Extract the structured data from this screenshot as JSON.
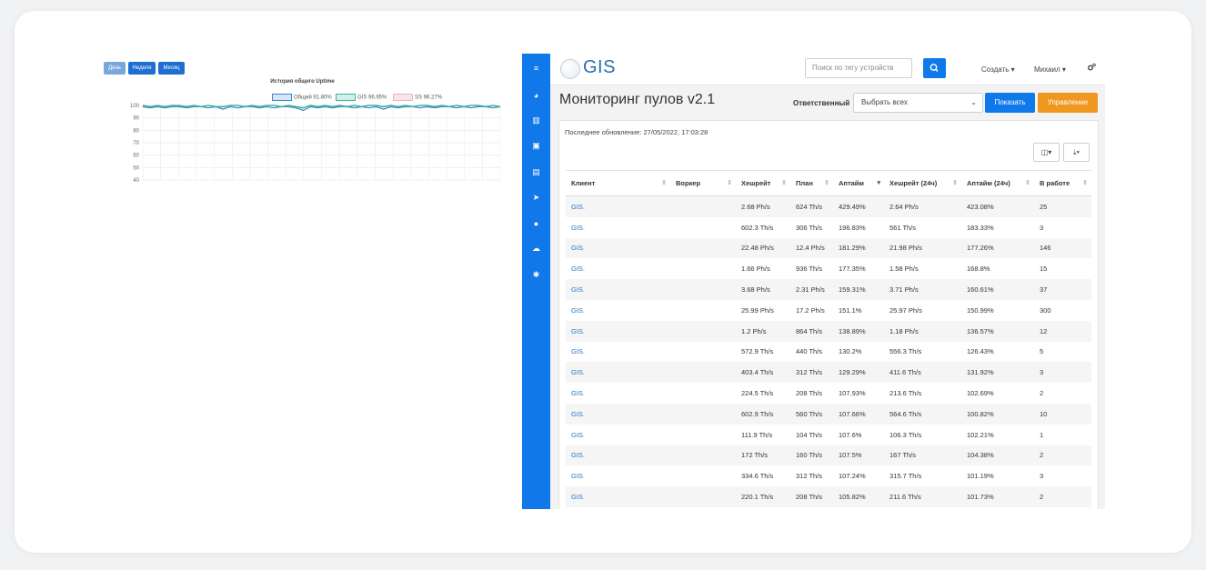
{
  "chart": {
    "buttons": [
      {
        "label": "День",
        "color": "#7aa7d9"
      },
      {
        "label": "Неделя",
        "color": "#1f6fd1"
      },
      {
        "label": "Месяц",
        "color": "#1f6fd1"
      }
    ],
    "title": "История общего Uptime",
    "legend": [
      "Общий 91.80%",
      "GIS 96.95%",
      "SS 96.27%"
    ]
  },
  "chart_data": {
    "type": "line",
    "title": "История общего Uptime",
    "yticks": [
      100,
      90,
      80,
      70,
      60,
      50,
      40
    ],
    "ylim": [
      40,
      100
    ],
    "grid": true,
    "legend_position": "top",
    "series": [
      {
        "name": "Общий 91.80%",
        "color": "#3e86c9",
        "values": [
          99,
          98,
          99,
          98,
          99,
          99,
          98,
          99,
          99,
          98,
          99,
          97,
          99,
          98,
          99,
          99,
          98,
          99,
          98,
          99,
          99,
          98,
          96,
          99,
          98,
          99,
          98,
          99,
          99,
          98,
          99,
          98,
          99,
          97,
          99,
          98,
          99,
          99,
          98,
          99,
          98,
          99,
          99,
          98,
          99,
          98,
          99,
          99,
          98,
          99
        ]
      },
      {
        "name": "GIS 96.95%",
        "color": "#3db39e",
        "values": [
          100,
          99,
          100,
          99,
          100,
          100,
          99,
          100,
          99,
          100,
          99,
          99,
          100,
          100,
          99,
          100,
          99,
          100,
          100,
          99,
          100,
          99,
          98,
          100,
          99,
          100,
          99,
          100,
          99,
          100,
          99,
          100,
          100,
          99,
          100,
          99,
          100,
          99,
          100,
          100,
          99,
          100,
          99,
          100,
          99,
          100,
          100,
          99,
          100,
          99
        ]
      },
      {
        "name": "SS 96.27%",
        "color": "#e07b86",
        "values": []
      }
    ]
  },
  "app": {
    "sidebar_icons": [
      "menu-icon",
      "dashboard-icon",
      "barcode-icon",
      "book-icon",
      "id-card-icon",
      "location-arrow-icon",
      "users-icon",
      "cloud-upload-icon",
      "gear-icon"
    ],
    "logo": {
      "text": "GIS"
    },
    "search": {
      "placeholder": "Поиск по тегу устройств"
    },
    "create_label": "Создать ▾",
    "user_label": "Михаил ▾",
    "title": "Мониторинг пулов v2.1",
    "responsible_label": "Ответственный",
    "responsible_value": "Выбрать всех",
    "show_label": "Показать",
    "manage_label": "Управление",
    "updated": "Последнее обновление: 27/05/2022, 17:03:28",
    "columns": [
      "Клиент",
      "Воркер",
      "Хешрейт",
      "План",
      "Аптайм",
      "Хешрейт (24ч)",
      "Аптайм (24ч)",
      "В работе"
    ],
    "rows": [
      {
        "client": "GIS.",
        "worker": "",
        "hashrate": "2.68 Ph/s",
        "plan": "624 Th/s",
        "uptime": "429.49%",
        "hashrate24": "2.64 Ph/s",
        "uptime24": "423.08%",
        "working": "25"
      },
      {
        "client": "GIS.",
        "worker": "",
        "hashrate": "602.3 Th/s",
        "plan": "306 Th/s",
        "uptime": "196.83%",
        "hashrate24": "561 Th/s",
        "uptime24": "183.33%",
        "working": "3"
      },
      {
        "client": "GIS.",
        "worker": "",
        "hashrate": "22.48 Ph/s",
        "plan": "12.4 Ph/s",
        "uptime": "181.29%",
        "hashrate24": "21.98 Ph/s",
        "uptime24": "177.26%",
        "working": "146"
      },
      {
        "client": "GIS.",
        "worker": "",
        "hashrate": "1.66 Ph/s",
        "plan": "936 Th/s",
        "uptime": "177.35%",
        "hashrate24": "1.58 Ph/s",
        "uptime24": "168.8%",
        "working": "15"
      },
      {
        "client": "GIS.",
        "worker": "",
        "hashrate": "3.68 Ph/s",
        "plan": "2.31 Ph/s",
        "uptime": "159.31%",
        "hashrate24": "3.71 Ph/s",
        "uptime24": "160.61%",
        "working": "37"
      },
      {
        "client": "GIS.",
        "worker": "",
        "hashrate": "25.99 Ph/s",
        "plan": "17.2 Ph/s",
        "uptime": "151.1%",
        "hashrate24": "25.97 Ph/s",
        "uptime24": "150.99%",
        "working": "300"
      },
      {
        "client": "GIS.",
        "worker": "",
        "hashrate": "1.2 Ph/s",
        "plan": "864 Th/s",
        "uptime": "138.89%",
        "hashrate24": "1.18 Ph/s",
        "uptime24": "136.57%",
        "working": "12"
      },
      {
        "client": "GIS.",
        "worker": "",
        "hashrate": "572.9 Th/s",
        "plan": "440 Th/s",
        "uptime": "130.2%",
        "hashrate24": "556.3 Th/s",
        "uptime24": "126.43%",
        "working": "5"
      },
      {
        "client": "GIS.",
        "worker": "",
        "hashrate": "403.4 Th/s",
        "plan": "312 Th/s",
        "uptime": "129.29%",
        "hashrate24": "411.6 Th/s",
        "uptime24": "131.92%",
        "working": "3"
      },
      {
        "client": "GIS.",
        "worker": "",
        "hashrate": "224.5 Th/s",
        "plan": "208 Th/s",
        "uptime": "107.93%",
        "hashrate24": "213.6 Th/s",
        "uptime24": "102.69%",
        "working": "2"
      },
      {
        "client": "GIS.",
        "worker": "",
        "hashrate": "602.9 Th/s",
        "plan": "560 Th/s",
        "uptime": "107.66%",
        "hashrate24": "564.6 Th/s",
        "uptime24": "100.82%",
        "working": "10"
      },
      {
        "client": "GIS.",
        "worker": "",
        "hashrate": "111.9 Th/s",
        "plan": "104 Th/s",
        "uptime": "107.6%",
        "hashrate24": "106.3 Th/s",
        "uptime24": "102.21%",
        "working": "1"
      },
      {
        "client": "GIS.",
        "worker": "",
        "hashrate": "172 Th/s",
        "plan": "160 Th/s",
        "uptime": "107.5%",
        "hashrate24": "167 Th/s",
        "uptime24": "104.38%",
        "working": "2"
      },
      {
        "client": "GIS.",
        "worker": "",
        "hashrate": "334.6 Th/s",
        "plan": "312 Th/s",
        "uptime": "107.24%",
        "hashrate24": "315.7 Th/s",
        "uptime24": "101.19%",
        "working": "3"
      },
      {
        "client": "GIS.",
        "worker": "",
        "hashrate": "220.1 Th/s",
        "plan": "208 Th/s",
        "uptime": "105.82%",
        "hashrate24": "211.6 Th/s",
        "uptime24": "101.73%",
        "working": "2"
      }
    ]
  }
}
